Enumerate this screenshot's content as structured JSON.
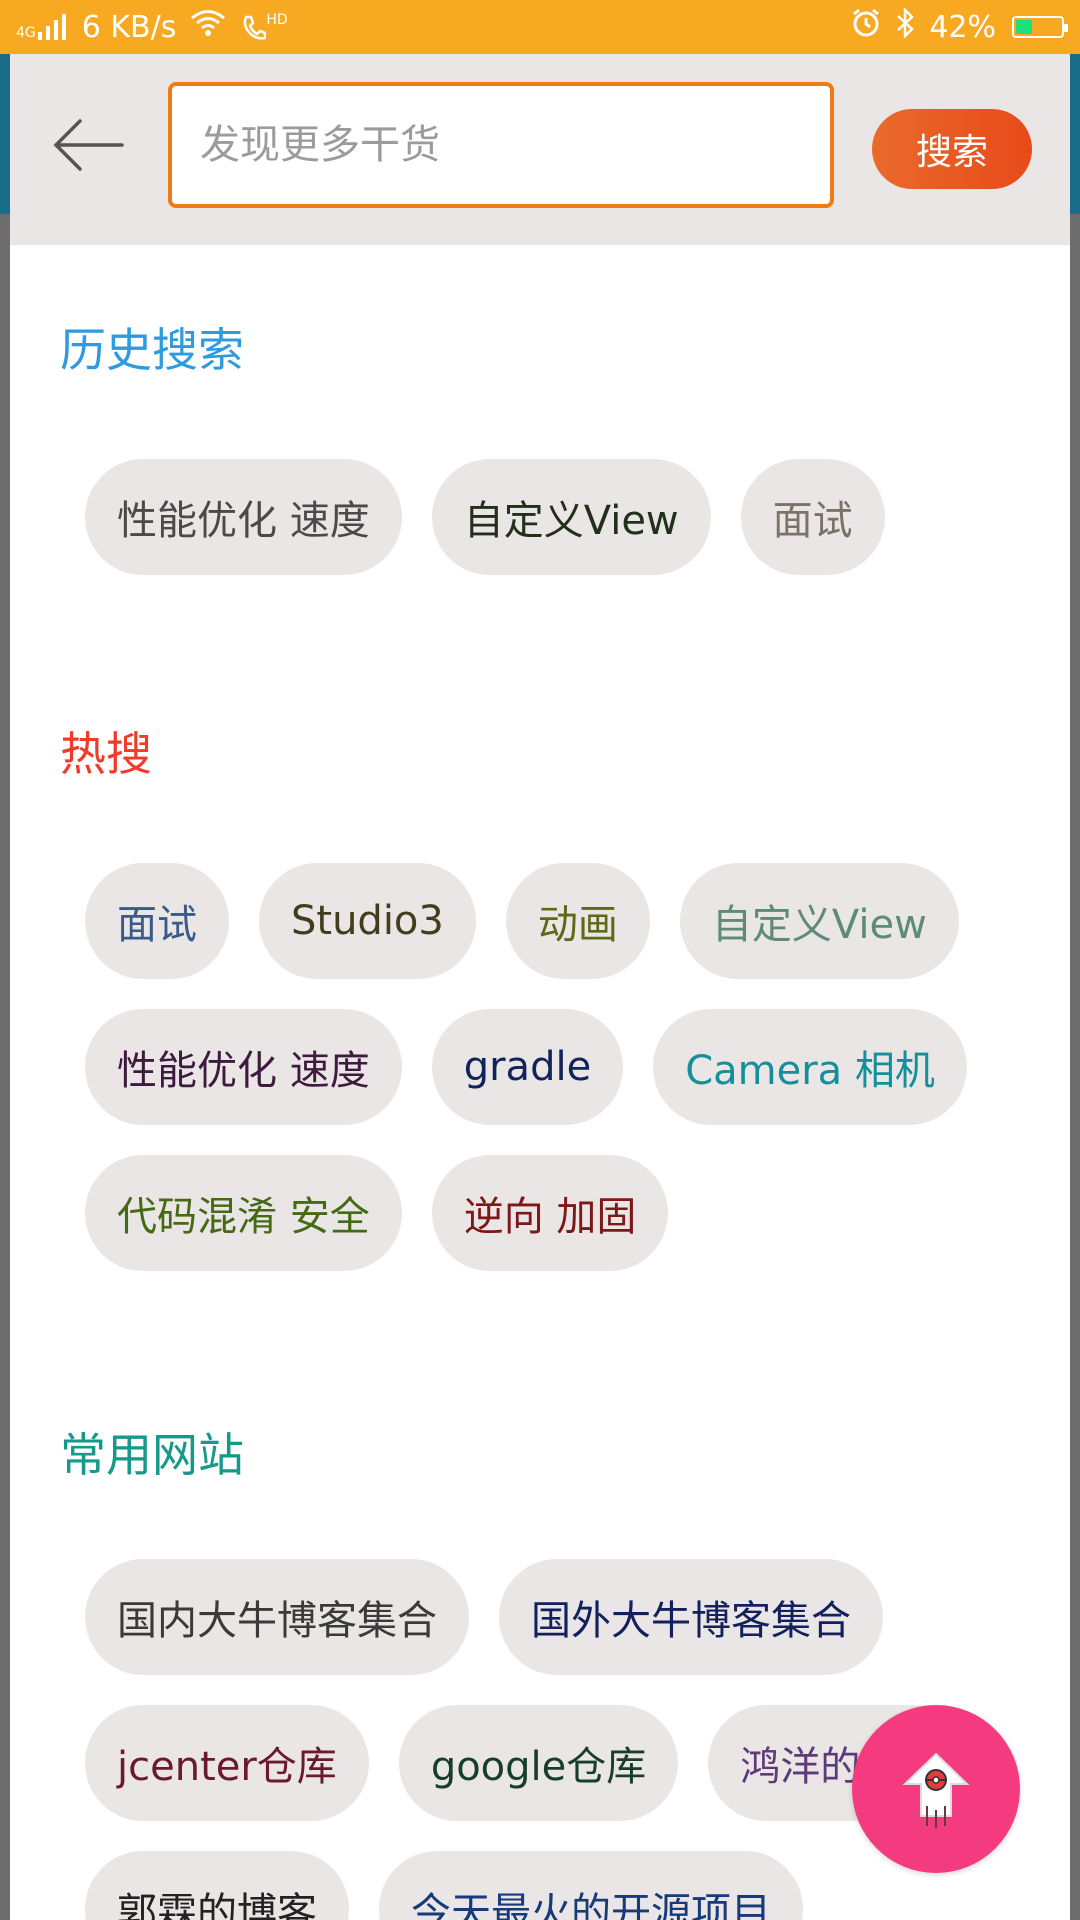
{
  "status_bar": {
    "network_type": "4G",
    "speed": "6 KB/s",
    "wifi_icon": "wifi-icon",
    "hd_label": "HD",
    "battery_percent": "42%",
    "battery_level": 0.42
  },
  "search": {
    "placeholder": "发现更多干货",
    "value": "",
    "button_label": "搜索"
  },
  "sections": [
    {
      "title": "历史搜索",
      "title_color": "#2e9be0",
      "chips": [
        {
          "label": "性能优化 速度",
          "color": "#4a4a4a"
        },
        {
          "label": "自定义View",
          "color": "#22301a"
        },
        {
          "label": "面试",
          "color": "#7a7468"
        }
      ]
    },
    {
      "title": "热搜",
      "title_color": "#f23a2a",
      "chips": [
        {
          "label": "面试",
          "color": "#3a5a8a"
        },
        {
          "label": "Studio3",
          "color": "#3f3f1e"
        },
        {
          "label": "动画",
          "color": "#5b6a16"
        },
        {
          "label": "自定义View",
          "color": "#5e8a7b"
        },
        {
          "label": "性能优化 速度",
          "color": "#3e1a3e"
        },
        {
          "label": "gradle",
          "color": "#10235b"
        },
        {
          "label": "Camera 相机",
          "color": "#13909a"
        },
        {
          "label": "代码混淆 安全",
          "color": "#456a14"
        },
        {
          "label": "逆向 加固",
          "color": "#7e1717"
        }
      ]
    },
    {
      "title": "常用网站",
      "title_color": "#15998a",
      "chips": [
        {
          "label": "国内大牛博客集合",
          "color": "#3a3a3a"
        },
        {
          "label": "国外大牛博客集合",
          "color": "#12205e"
        },
        {
          "label": "jcenter仓库",
          "color": "#6a1a2a"
        },
        {
          "label": "google仓库",
          "color": "#173e2c"
        },
        {
          "label": "鸿洋的博客",
          "color": "#5e3a7a"
        },
        {
          "label": "郭霖的博客",
          "color": "#222222"
        },
        {
          "label": "今天最火的开源项目",
          "color": "#163a7a"
        }
      ]
    }
  ],
  "fab": {
    "icon": "rocket-up-icon",
    "color": "#f53b7f"
  }
}
